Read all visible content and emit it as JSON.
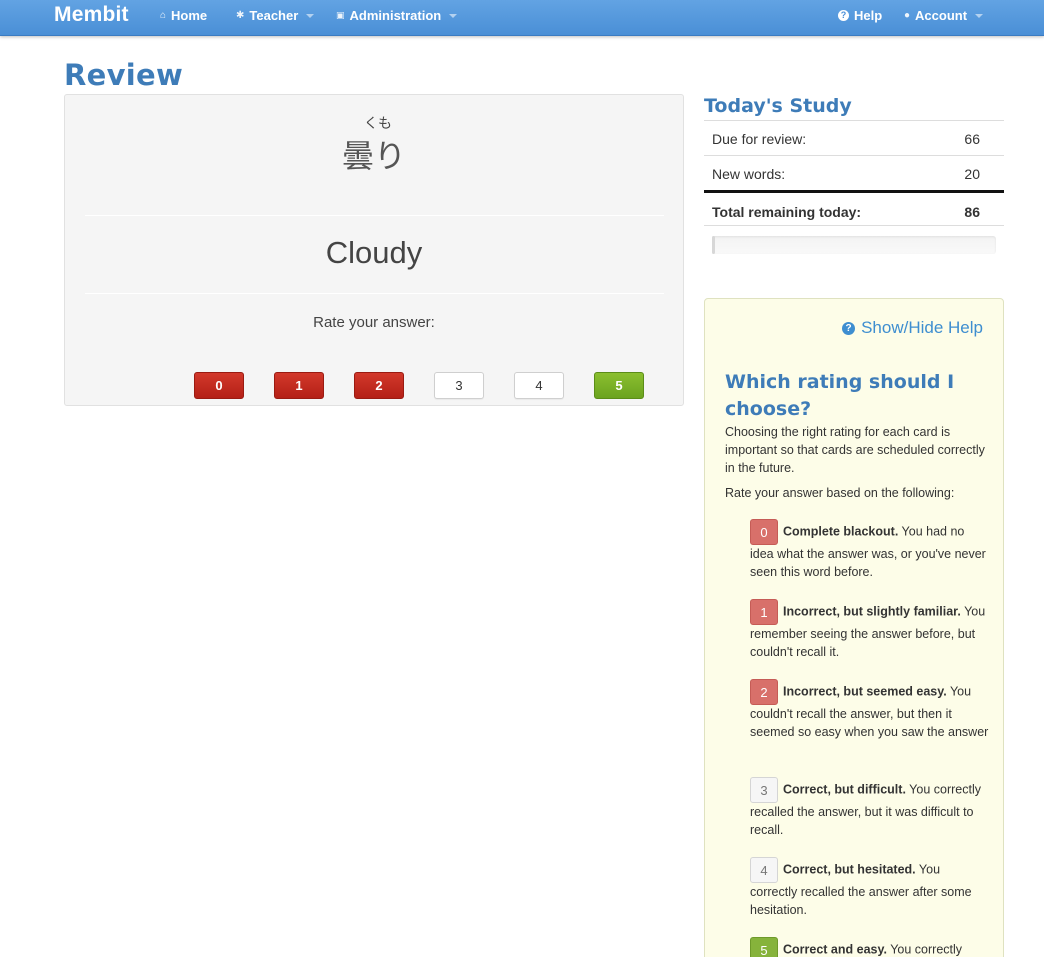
{
  "navbar": {
    "brand": "Membit",
    "items": [
      {
        "label": "Home",
        "icon": "home-icon",
        "glyph": "⌂",
        "caret": false
      },
      {
        "label": "Teacher",
        "icon": "gear-icon",
        "glyph": "✱",
        "caret": true
      },
      {
        "label": "Administration",
        "icon": "lock-icon",
        "glyph": "🔒",
        "caret": true
      }
    ],
    "right_items": [
      {
        "label": "Help",
        "icon": "question-circle-icon",
        "glyph": "?",
        "caret": false
      },
      {
        "label": "Account",
        "icon": "user-icon",
        "glyph": "👤",
        "caret": true
      }
    ]
  },
  "page": {
    "title": "Review"
  },
  "card": {
    "reading": "くも",
    "word": "曇り",
    "answer": "Cloudy",
    "rate_label": "Rate your answer:",
    "buttons": [
      "0",
      "1",
      "2",
      "3",
      "4",
      "5"
    ]
  },
  "study": {
    "title": "Today's Study",
    "rows": [
      {
        "label": "Due for review:",
        "value": "66"
      },
      {
        "label": "New words:",
        "value": "20"
      }
    ],
    "total": {
      "label": "Total remaining today:",
      "value": "86"
    },
    "progress_fraction": 0.01
  },
  "help": {
    "toggle_label": "Show/Hide Help",
    "title": "Which rating should I choose?",
    "intro": "Choosing the right rating for each card is important so that cards are scheduled correctly in the future.",
    "intro2": "Rate your answer based on the following:",
    "ratings": [
      {
        "num": "0",
        "heading": "Complete blackout.",
        "text": "You had no idea what the answer was, or you've never seen this word before."
      },
      {
        "num": "1",
        "heading": "Incorrect, but slightly familiar.",
        "text": "You remember seeing the answer before, but couldn't recall it."
      },
      {
        "num": "2",
        "heading": "Incorrect, but seemed easy.",
        "text": "You couldn't recall the answer, but then it seemed so easy when you saw the answer"
      },
      {
        "num": "3",
        "heading": "Correct, but difficult.",
        "text": "You correctly recalled the answer, but it was difficult to recall."
      },
      {
        "num": "4",
        "heading": "Correct, but hesitated.",
        "text": "You correctly recalled the answer after some hesitation."
      },
      {
        "num": "5",
        "heading": "Correct and easy.",
        "text": "You correctly"
      }
    ]
  },
  "colors": {
    "navbar": "#4a90d9",
    "title_blue": "#3e7cb8",
    "red": "#c0261a",
    "green": "#78ad24",
    "help_bg": "#fdfde8"
  }
}
